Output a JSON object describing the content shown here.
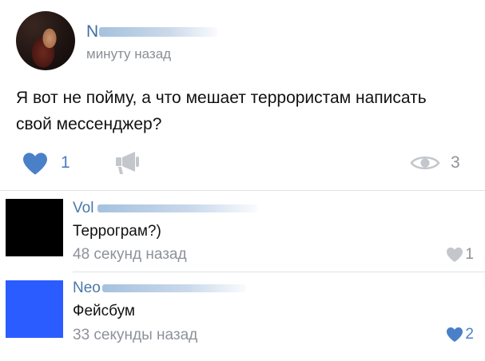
{
  "post": {
    "author_name": "N",
    "time": "минуту назад",
    "text": "Я вот не пойму, а что мешает террористам написать свой мессенджер?",
    "likes": "1",
    "views": "3",
    "colors": {
      "like_active": "#4a80c8",
      "icon_gray": "#c3c7cc"
    }
  },
  "comments": [
    {
      "author_name": "Vol",
      "text": "Террограм?)",
      "time": "48 секунд назад",
      "likes": "1",
      "avatar_color": "#000000",
      "liked": false
    },
    {
      "author_name": "Neo",
      "text": "Фейсбум",
      "time": "33 секунды назад",
      "likes": "2",
      "avatar_color": "#2a5cff",
      "liked": true
    }
  ]
}
